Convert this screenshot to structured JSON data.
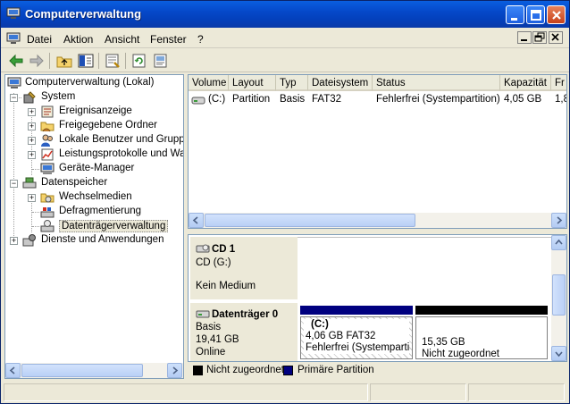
{
  "window": {
    "title": "Computerverwaltung"
  },
  "menu": {
    "items": [
      "Datei",
      "Aktion",
      "Ansicht",
      "Fenster",
      "?"
    ]
  },
  "toolbar": {
    "buttons": [
      "back-icon",
      "forward-icon",
      "up-folder-icon",
      "show-hide-tree-icon",
      "properties-icon",
      "refresh-icon",
      "help-icon"
    ]
  },
  "tree": {
    "root": "Computerverwaltung (Lokal)",
    "system": {
      "label": "System",
      "children": [
        "Ereignisanzeige",
        "Freigegebene Ordner",
        "Lokale Benutzer und Gruppen",
        "Leistungsprotokolle und Warnungen",
        "Geräte-Manager"
      ]
    },
    "storage": {
      "label": "Datenspeicher",
      "children": [
        "Wechselmedien",
        "Defragmentierung",
        "Datenträgerverwaltung"
      ]
    },
    "services": {
      "label": "Dienste und Anwendungen"
    }
  },
  "volumes": {
    "columns": [
      "Volume",
      "Layout",
      "Typ",
      "Dateisystem",
      "Status",
      "Kapazität",
      "Fr"
    ],
    "rows": [
      {
        "volume": "(C:)",
        "layout": "Partition",
        "typ": "Basis",
        "dateisystem": "FAT32",
        "status": "Fehlerfrei (Systempartition)",
        "kapazitaet": "4,05 GB",
        "frei": "1,8"
      }
    ]
  },
  "disks": [
    {
      "name": "CD 1",
      "line1": "CD (G:)",
      "line2": "",
      "line3": "Kein Medium"
    },
    {
      "name": "Datenträger 0",
      "line1": "Basis",
      "line2": "19,41 GB",
      "line3": "Online",
      "partitions": [
        {
          "title": "(C:)",
          "size": "4,06 GB FAT32",
          "status": "Fehlerfrei (Systempartit",
          "color": "#00007f"
        },
        {
          "title": "",
          "size": "15,35 GB",
          "status": "Nicht zugeordnet",
          "color": "#000000"
        }
      ]
    }
  ],
  "legend": [
    {
      "label": "Nicht zugeordnet",
      "color": "#000000"
    },
    {
      "label": "Primäre Partition",
      "color": "#00007f"
    }
  ]
}
